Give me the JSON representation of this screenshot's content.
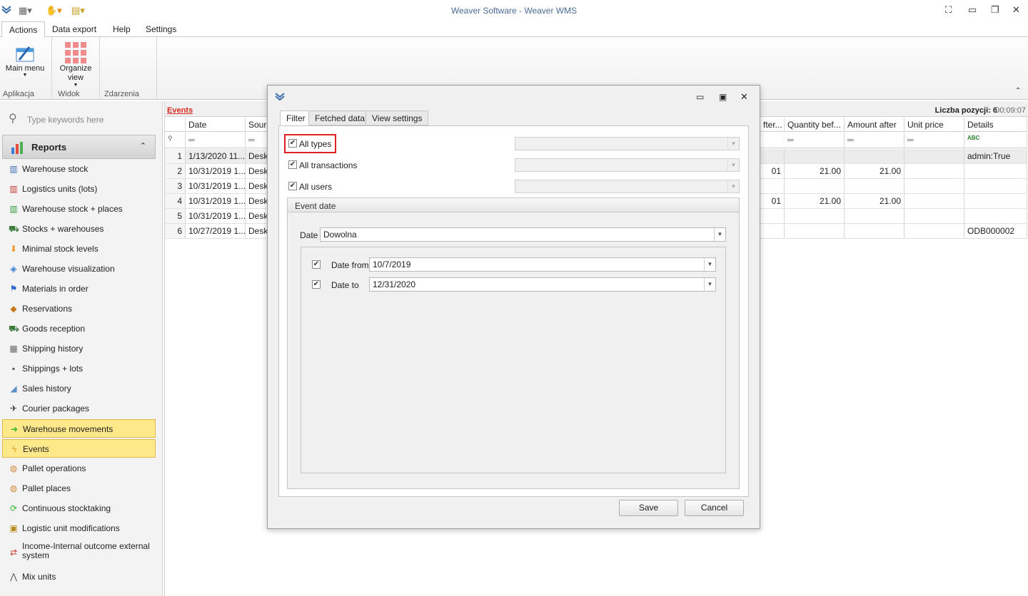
{
  "window": {
    "title": "Weaver Software - Weaver WMS"
  },
  "menu": {
    "tabs": [
      "Actions",
      "Data export",
      "Help",
      "Settings"
    ]
  },
  "ribbon": {
    "main_menu": "Main menu",
    "organize_view": "Organize view",
    "groups": [
      "Aplikacja",
      "Widok",
      "Zdarzenia"
    ]
  },
  "sidebar": {
    "search_placeholder": "Type keywords here",
    "section": "Reports",
    "items": [
      {
        "label": "Warehouse stock",
        "icon": "warehouse-icon"
      },
      {
        "label": "Logistics units (lots)",
        "icon": "lot-icon"
      },
      {
        "label": "Warehouse stock + places",
        "icon": "places-icon"
      },
      {
        "label": "Stocks + warehouses",
        "icon": "truck-icon"
      },
      {
        "label": "Minimal stock levels",
        "icon": "arrow-down-icon"
      },
      {
        "label": "Warehouse visualization",
        "icon": "map-icon"
      },
      {
        "label": "Materials in order",
        "icon": "flag-icon"
      },
      {
        "label": "Reservations",
        "icon": "tag-icon"
      },
      {
        "label": "Goods reception",
        "icon": "truck-icon"
      },
      {
        "label": "Shipping history",
        "icon": "boxes-icon"
      },
      {
        "label": "Shippings + lots",
        "icon": "box-icon"
      },
      {
        "label": "Sales history",
        "icon": "sales-icon"
      },
      {
        "label": "Courier packages",
        "icon": "plane-icon"
      },
      {
        "label": "Warehouse movements",
        "icon": "arrow-right-icon"
      },
      {
        "label": "Events",
        "icon": "lightning-icon"
      },
      {
        "label": "Pallet operations",
        "icon": "pallet-icon"
      },
      {
        "label": "Pallet places",
        "icon": "pallet-icon"
      },
      {
        "label": "Continuous stocktaking",
        "icon": "refresh-icon"
      },
      {
        "label": "Logistic unit modifications",
        "icon": "unit-icon"
      },
      {
        "label": "Income-Internal outcome external system",
        "icon": "exchange-icon"
      },
      {
        "label": "Mix units",
        "icon": "mix-icon"
      }
    ]
  },
  "grid": {
    "title": "Events",
    "count_label": "Liczba pozycji: 6",
    "time": "00:09:07",
    "columns_left": [
      "Date",
      "Sourc"
    ],
    "columns_right": [
      "fter...",
      "Quantity bef...",
      "Amount after",
      "Unit price",
      "Details"
    ],
    "rows": [
      {
        "n": "1",
        "date": "1/13/2020 11...",
        "src": "Deskt",
        "c1": "",
        "qty": "",
        "amt": "",
        "price": "",
        "details": "admin:True"
      },
      {
        "n": "2",
        "date": "10/31/2019 1...",
        "src": "Deskt",
        "c1": "01",
        "qty": "21.00",
        "amt": "21.00",
        "price": "",
        "details": ""
      },
      {
        "n": "3",
        "date": "10/31/2019 1...",
        "src": "Deskt",
        "c1": "",
        "qty": "",
        "amt": "",
        "price": "",
        "details": ""
      },
      {
        "n": "4",
        "date": "10/31/2019 1...",
        "src": "Deskt",
        "c1": "01",
        "qty": "21.00",
        "amt": "21.00",
        "price": "",
        "details": ""
      },
      {
        "n": "5",
        "date": "10/31/2019 1...",
        "src": "Deskt",
        "c1": "",
        "qty": "",
        "amt": "",
        "price": "",
        "details": ""
      },
      {
        "n": "6",
        "date": "10/27/2019 1...",
        "src": "Deskt",
        "c1": "",
        "qty": "",
        "amt": "",
        "price": "",
        "details": "ODB000002"
      }
    ]
  },
  "dialog": {
    "tabs": [
      "Filter",
      "Fetched data",
      "View settings"
    ],
    "all_types": "All types",
    "all_transactions": "All transactions",
    "all_users": "All users",
    "event_date_group": "Event date",
    "date_label": "Date",
    "date_value": "Dowolna",
    "date_from_label": "Date from",
    "date_from_value": "10/7/2019",
    "date_to_label": "Date to",
    "date_to_value": "12/31/2020",
    "save": "Save",
    "cancel": "Cancel"
  }
}
